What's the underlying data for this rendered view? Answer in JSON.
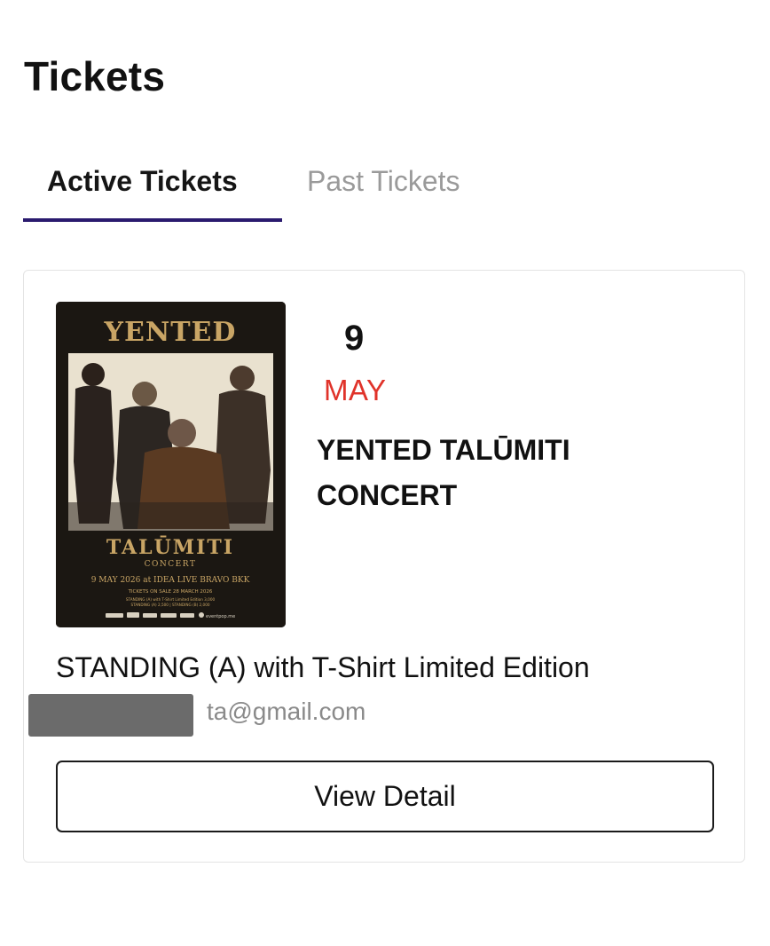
{
  "header": {
    "title": "Tickets"
  },
  "tabs": [
    {
      "label": "Active Tickets",
      "active": true
    },
    {
      "label": "Past Tickets",
      "active": false
    }
  ],
  "colors": {
    "tab_underline": "#2a1a6e",
    "month": "#e0332a",
    "poster_bg": "#1b1712",
    "poster_gold": "#c9a565"
  },
  "ticket": {
    "day": "9",
    "month": "MAY",
    "event_title": "YENTED TALŪMITI CONCERT",
    "ticket_type": "STANDING (A) with T-Shirt Limited Edition",
    "email_visible": "ta@gmail.com",
    "view_button": "View Detail",
    "poster": {
      "brand": "YENTED",
      "name": "TALŪMITI",
      "subtitle": "CONCERT",
      "date_venue": "9 MAY 2026 at IDEA LIVE BRAVO BKK",
      "on_sale": "TICKETS ON SALE 28 MARCH 2026",
      "price_line_1": "STANDING (A) with T-Shirt Limited Edition 3,000",
      "price_line_2": "STANDING (A) 2,500 | STANDING (B) 2,000",
      "sponsor_logo": "eventpop.me"
    }
  }
}
